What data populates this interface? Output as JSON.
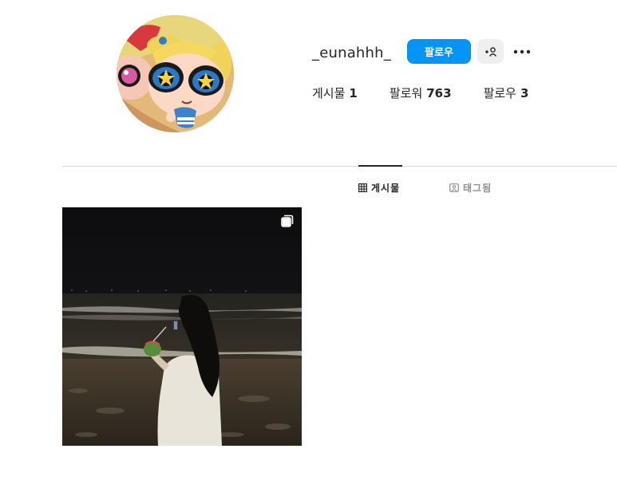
{
  "profile": {
    "username": "_eunahhh_",
    "follow_label": "팔로우"
  },
  "stats": {
    "posts_label": "게시물",
    "posts_count": "1",
    "followers_label": "팔로워",
    "followers_count": "763",
    "following_label": "팔로우",
    "following_count": "3"
  },
  "tabs": {
    "posts_label": "게시물",
    "tagged_label": "태그됨"
  },
  "icons": {
    "suggest": "person-add-icon",
    "more": "more-horizontal-icon",
    "posts_tab": "grid-icon",
    "tagged_tab": "tag-photo-icon",
    "carousel": "carousel-icon"
  },
  "colors": {
    "follow_button": "#0095f6",
    "secondary_button": "#efefef",
    "text": "#262626",
    "muted_text": "#8e8e8e",
    "divider": "#dbdbdb"
  }
}
